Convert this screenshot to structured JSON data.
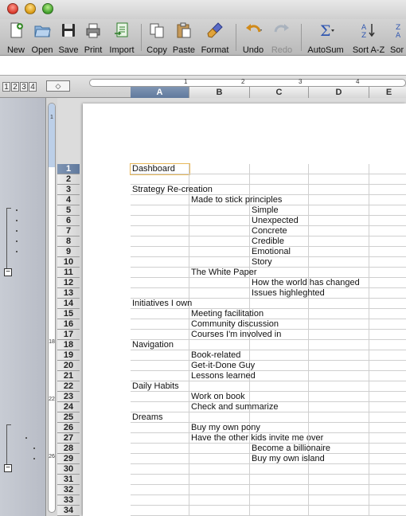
{
  "toolbar": {
    "buttons": [
      {
        "label": "New",
        "icon": "new-document-icon",
        "enabled": true
      },
      {
        "label": "Open",
        "icon": "open-folder-icon",
        "enabled": true
      },
      {
        "label": "Save",
        "icon": "floppy-disk-icon",
        "enabled": true
      },
      {
        "label": "Print",
        "icon": "printer-icon",
        "enabled": true
      },
      {
        "label": "Import",
        "icon": "import-icon",
        "enabled": true
      },
      {
        "label": "Copy",
        "icon": "copy-icon",
        "enabled": true
      },
      {
        "label": "Paste",
        "icon": "paste-icon",
        "enabled": true
      },
      {
        "label": "Format",
        "icon": "format-brush-icon",
        "enabled": true
      },
      {
        "label": "Undo",
        "icon": "undo-icon",
        "enabled": true
      },
      {
        "label": "Redo",
        "icon": "redo-icon",
        "enabled": false
      },
      {
        "label": "AutoSum",
        "icon": "sigma-icon",
        "enabled": true
      },
      {
        "label": "Sort A-Z",
        "icon": "sort-az-icon",
        "enabled": true
      },
      {
        "label": "Sor",
        "icon": "sort-za-icon",
        "enabled": true
      }
    ]
  },
  "outline_levels": [
    "1",
    "2",
    "3",
    "4"
  ],
  "ruler": {
    "h_numbers": [
      "1",
      "2",
      "3",
      "4"
    ],
    "v_numbers": [
      "1",
      "18",
      "22",
      "26"
    ]
  },
  "columns": [
    "A",
    "B",
    "C",
    "D",
    "E"
  ],
  "selected_column": "A",
  "selected_row": "1",
  "rows": [
    {
      "num": "1",
      "a": "Dashboard",
      "b": "",
      "c": ""
    },
    {
      "num": "2",
      "a": "",
      "b": "",
      "c": ""
    },
    {
      "num": "3",
      "a": "Strategy Re-creation",
      "b": "",
      "c": ""
    },
    {
      "num": "4",
      "a": "",
      "b": "Made to stick principles",
      "c": ""
    },
    {
      "num": "5",
      "a": "",
      "b": "",
      "c": "Simple"
    },
    {
      "num": "6",
      "a": "",
      "b": "",
      "c": "Unexpected"
    },
    {
      "num": "7",
      "a": "",
      "b": "",
      "c": "Concrete"
    },
    {
      "num": "8",
      "a": "",
      "b": "",
      "c": "Credible"
    },
    {
      "num": "9",
      "a": "",
      "b": "",
      "c": "Emotional"
    },
    {
      "num": "10",
      "a": "",
      "b": "",
      "c": "Story"
    },
    {
      "num": "11",
      "a": "",
      "b": "The White Paper",
      "c": ""
    },
    {
      "num": "12",
      "a": "",
      "b": "",
      "c": "How the world has changed"
    },
    {
      "num": "13",
      "a": "",
      "b": "",
      "c": "Issues highleghted"
    },
    {
      "num": "14",
      "a": "Initiatives I own",
      "b": "",
      "c": ""
    },
    {
      "num": "15",
      "a": "",
      "b": "Meeting facilitation",
      "c": ""
    },
    {
      "num": "16",
      "a": "",
      "b": "Community discussion",
      "c": ""
    },
    {
      "num": "17",
      "a": "",
      "b": "Courses I'm involved in",
      "c": ""
    },
    {
      "num": "18",
      "a": "Navigation",
      "b": "",
      "c": ""
    },
    {
      "num": "19",
      "a": "",
      "b": "Book-related",
      "c": ""
    },
    {
      "num": "20",
      "a": "",
      "b": "Get-it-Done Guy",
      "c": ""
    },
    {
      "num": "21",
      "a": "",
      "b": "Lessons learned",
      "c": ""
    },
    {
      "num": "22",
      "a": "Daily Habits",
      "b": "",
      "c": ""
    },
    {
      "num": "23",
      "a": "",
      "b": "Work on book",
      "c": ""
    },
    {
      "num": "24",
      "a": "",
      "b": "Check and summarize",
      "c": ""
    },
    {
      "num": "25",
      "a": "Dreams",
      "b": "",
      "c": ""
    },
    {
      "num": "26",
      "a": "",
      "b": "Buy my own pony",
      "c": ""
    },
    {
      "num": "27",
      "a": "",
      "b": "Have the other kids invite me over",
      "c": ""
    },
    {
      "num": "28",
      "a": "",
      "b": "",
      "c": "Become a billionaire"
    },
    {
      "num": "29",
      "a": "",
      "b": "",
      "c": "Buy my own island"
    },
    {
      "num": "30",
      "a": "",
      "b": "",
      "c": ""
    },
    {
      "num": "31",
      "a": "",
      "b": "",
      "c": ""
    },
    {
      "num": "32",
      "a": "",
      "b": "",
      "c": ""
    },
    {
      "num": "33",
      "a": "",
      "b": "",
      "c": ""
    },
    {
      "num": "34",
      "a": "",
      "b": "",
      "c": ""
    }
  ],
  "colors": {
    "selection_header": "#6a83a8",
    "active_cell_border": "#e8b85a",
    "gridline": "#cfcfcf"
  }
}
